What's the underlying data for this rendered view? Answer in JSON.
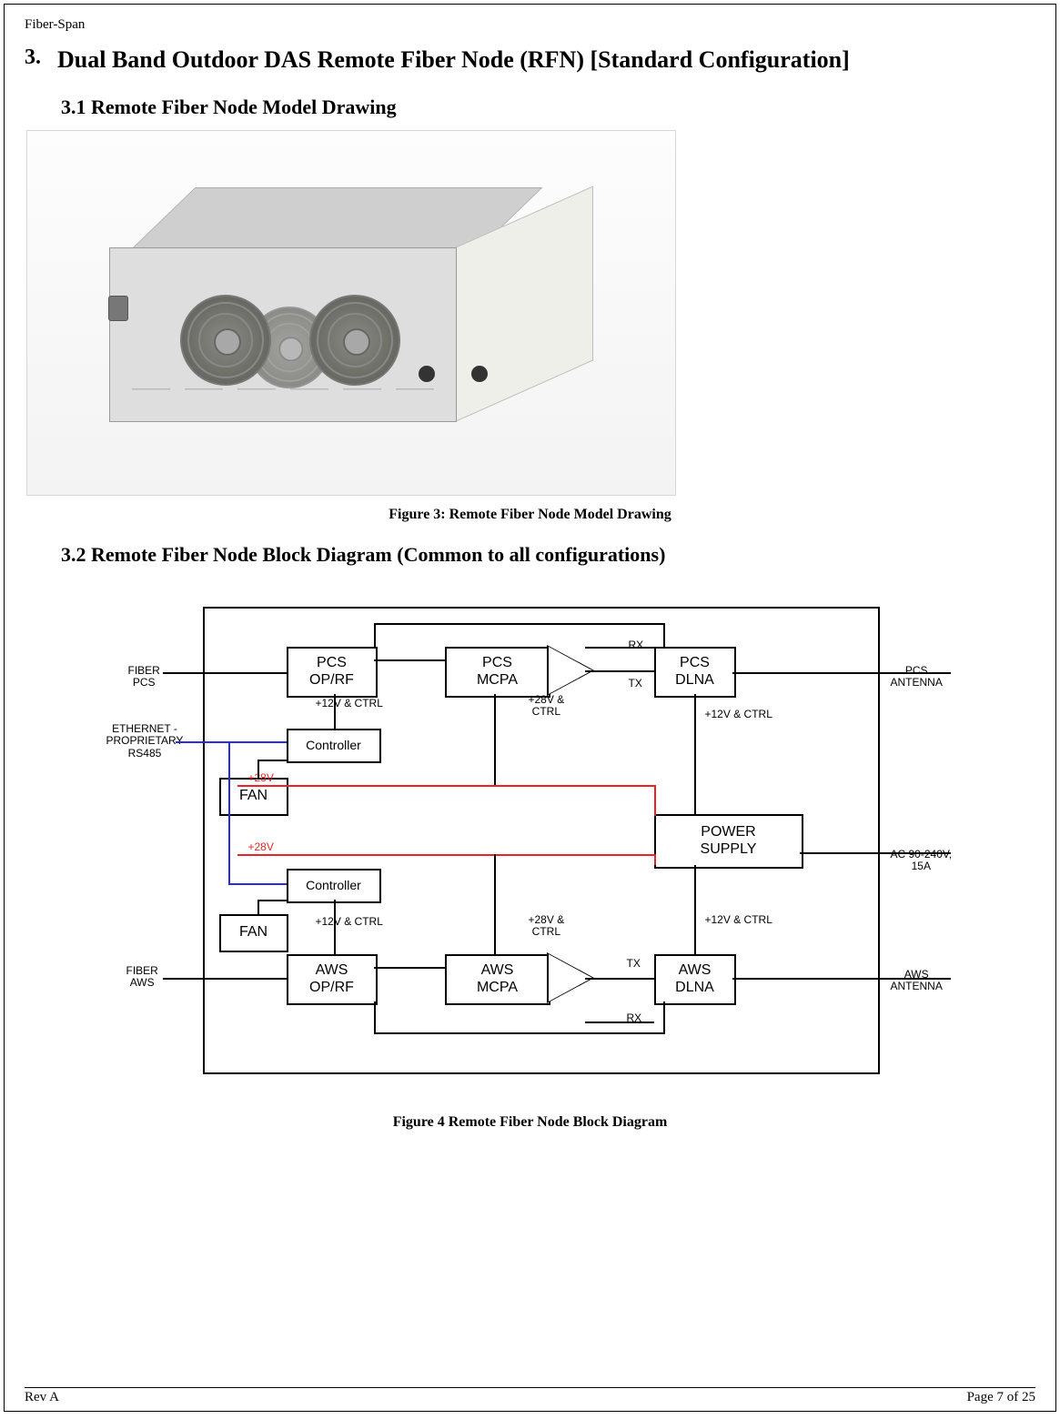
{
  "header": {
    "company": "Fiber-Span"
  },
  "section": {
    "number": "3.",
    "title": "Dual Band Outdoor DAS Remote Fiber Node (RFN) [Standard Configuration]"
  },
  "sub1": {
    "title": "3.1 Remote Fiber Node Model Drawing"
  },
  "fig3": {
    "caption": "Figure 3: Remote Fiber Node Model Drawing"
  },
  "sub2": {
    "title": "3.2 Remote Fiber Node Block Diagram (Common to all configurations)"
  },
  "diagram": {
    "blocks": {
      "pcs_oprf": "PCS\nOP/RF",
      "pcs_mcpa": "PCS\nMCPA",
      "pcs_dlna": "PCS\nDLNA",
      "controller1": "Controller",
      "controller2": "Controller",
      "fan1": "FAN",
      "fan2": "FAN",
      "power": "POWER\nSUPPLY",
      "aws_oprf": "AWS\nOP/RF",
      "aws_mcpa": "AWS\nMCPA",
      "aws_dlna": "AWS\nDLNA"
    },
    "left_labels": {
      "fiber_pcs": "FIBER\nPCS",
      "eth": "ETHERNET -\nPROPRIETARY\nRS485",
      "fiber_aws": "FIBER\nAWS"
    },
    "right_labels": {
      "pcs_ant": "PCS\nANTENNA",
      "ac": "AC 90-240V,\n15A",
      "aws_ant": "AWS\nANTENNA"
    },
    "small_labels": {
      "rx": "RX",
      "tx": "TX",
      "p12ctrl": "+12V & CTRL",
      "p28ctrl": "+28V &\nCTRL",
      "p28v": "+28V"
    }
  },
  "fig4": {
    "caption": "Figure 4 Remote Fiber Node Block Diagram"
  },
  "footer": {
    "rev": "Rev A",
    "page": "Page 7 of 25"
  }
}
